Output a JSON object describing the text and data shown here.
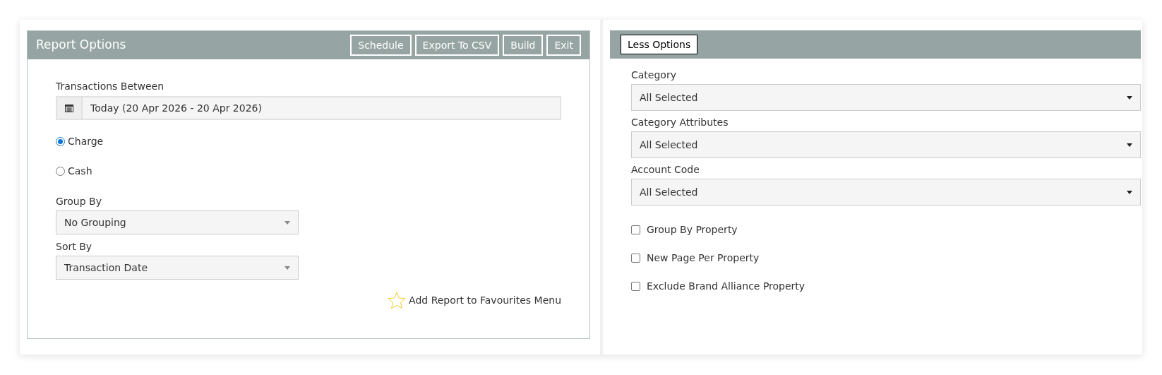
{
  "report_options": {
    "title": "Report Options",
    "buttons": [
      "Schedule",
      "Export To CSV",
      "Build",
      "Exit"
    ],
    "date_range": {
      "label": "Transactions Between",
      "value": "Today (20 Apr 2026 - 20 Apr 2026)"
    },
    "basis": [
      {
        "label": "Charge",
        "selected": true
      },
      {
        "label": "Cash",
        "selected": false
      }
    ],
    "selects": [
      {
        "label": "Group By",
        "value": "No Grouping"
      },
      {
        "label": "Sort By",
        "value": "Transaction Date"
      }
    ],
    "favourites_link": "Add Report to Favourites Menu"
  },
  "more_options": {
    "toggle_button": "Less Options",
    "selects": [
      {
        "label": "Category",
        "value": "All Selected"
      },
      {
        "label": "Category Attributes",
        "value": "All Selected"
      },
      {
        "label": "Account Code",
        "value": "All Selected"
      }
    ],
    "checkboxes": [
      {
        "label": "Group By Property",
        "checked": false
      },
      {
        "label": "New Page Per Property",
        "checked": false
      },
      {
        "label": "Exclude Brand Alliance Property",
        "checked": false
      }
    ]
  }
}
